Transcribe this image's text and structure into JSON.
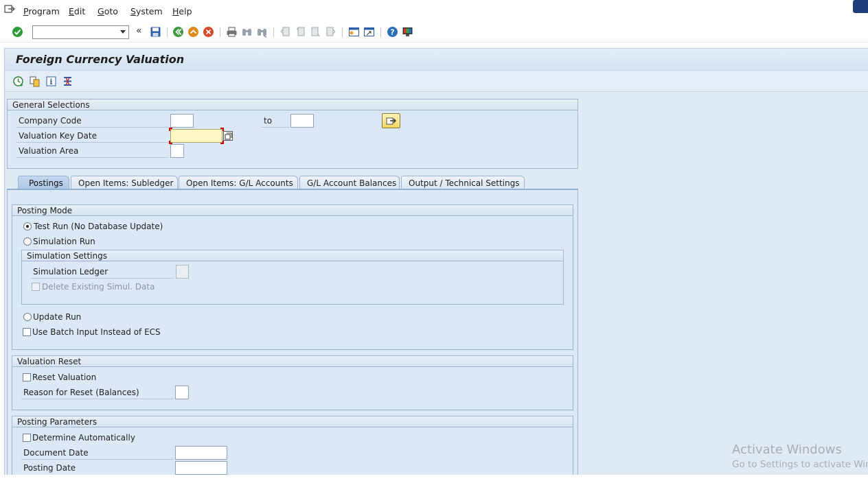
{
  "menu": {
    "items": [
      {
        "label": "Program",
        "accel": "P"
      },
      {
        "label": "Edit",
        "accel": "E"
      },
      {
        "label": "Goto",
        "accel": "G"
      },
      {
        "label": "System",
        "accel": "S"
      },
      {
        "label": "Help",
        "accel": "H"
      }
    ]
  },
  "toolbar": {
    "command_value": "",
    "command_placeholder": "",
    "back_glyph": "«"
  },
  "screen": {
    "title": "Foreign Currency Valuation"
  },
  "general_selections": {
    "title": "General Selections",
    "company_code_label": "Company Code",
    "company_code_from": "",
    "to_label": "to",
    "company_code_to": "",
    "valuation_key_date_label": "Valuation Key Date",
    "valuation_key_date": "",
    "valuation_area_label": "Valuation Area",
    "valuation_area": ""
  },
  "tabs": [
    {
      "label": "Postings",
      "active": true
    },
    {
      "label": "Open Items: Subledger",
      "active": false
    },
    {
      "label": "Open Items: G/L Accounts",
      "active": false
    },
    {
      "label": "G/L Account Balances",
      "active": false
    },
    {
      "label": "Output / Technical Settings",
      "active": false
    }
  ],
  "posting_mode": {
    "title": "Posting Mode",
    "test_run": "Test Run (No Database Update)",
    "simulation_run": "Simulation Run",
    "simulation_settings_title": "Simulation Settings",
    "simulation_ledger_label": "Simulation Ledger",
    "simulation_ledger": "",
    "delete_simul_label": "Delete Existing Simul. Data",
    "update_run": "Update Run",
    "batch_input_label": "Use Batch Input Instead of ECS",
    "selected": "test_run"
  },
  "valuation_reset": {
    "title": "Valuation Reset",
    "reset_label": "Reset Valuation",
    "reason_label": "Reason for Reset (Balances)",
    "reason": ""
  },
  "posting_parameters": {
    "title": "Posting Parameters",
    "determine_label": "Determine Automatically",
    "document_date_label": "Document Date",
    "document_date": "",
    "posting_date_label": "Posting Date",
    "posting_date": ""
  },
  "watermark": {
    "line1": "Activate Windows",
    "line2": "Go to Settings to activate Win"
  },
  "colors": {
    "background": "#dfeaf5",
    "required_field": "#fff8c4",
    "active_tab": "#a9c6e4",
    "enter_icon": "#2e9b3a",
    "cancel_icon": "#d84b2a"
  }
}
